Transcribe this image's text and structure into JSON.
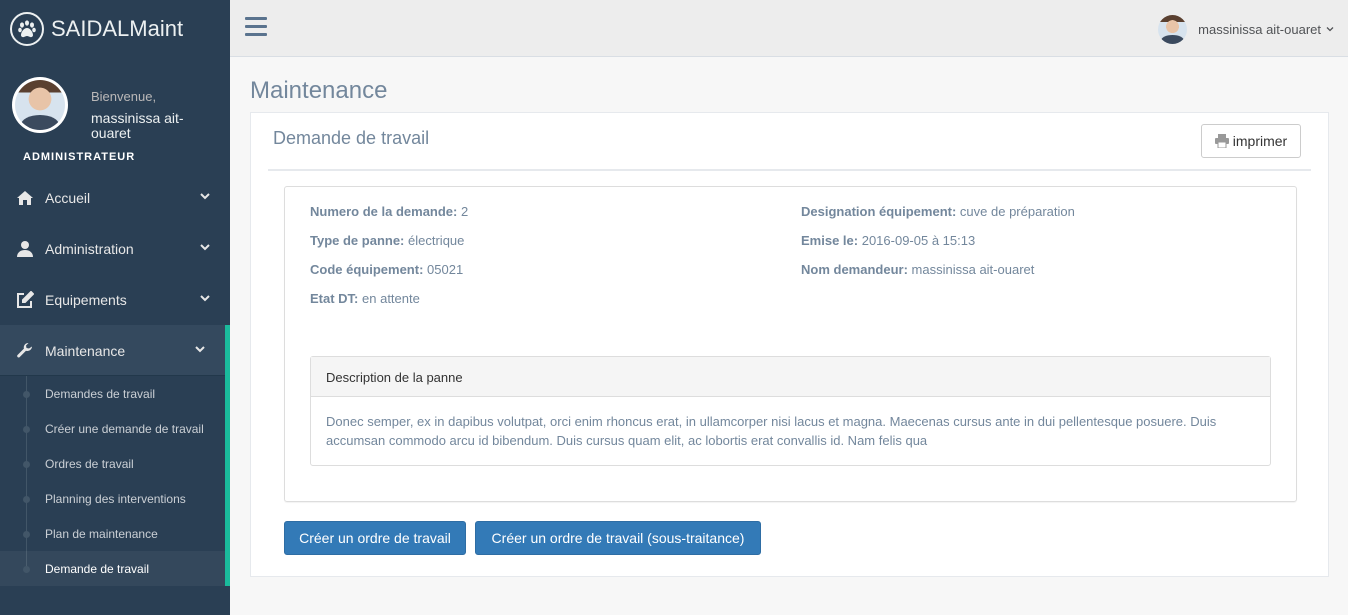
{
  "brand": {
    "name": "SAIDALMaint",
    "icon": "paw-icon"
  },
  "profile": {
    "welcome": "Bienvenue,",
    "name": "massinissa ait-ouaret",
    "role": "ADMINISTRATEUR"
  },
  "menu": [
    {
      "label": "Accueil",
      "icon": "home-icon"
    },
    {
      "label": "Administration",
      "icon": "user-icon"
    },
    {
      "label": "Equipements",
      "icon": "edit-icon"
    },
    {
      "label": "Maintenance",
      "icon": "wrench-icon"
    }
  ],
  "submenu": [
    {
      "label": "Demandes de travail"
    },
    {
      "label": "Créer une demande de travail"
    },
    {
      "label": "Ordres de travail"
    },
    {
      "label": "Planning des interventions"
    },
    {
      "label": "Plan de maintenance"
    },
    {
      "label": "Demande de travail"
    }
  ],
  "topnav": {
    "user": "massinissa ait-ouaret"
  },
  "page": {
    "title": "Maintenance"
  },
  "panel": {
    "title": "Demande de travail",
    "print_label": "imprimer",
    "fields": {
      "numero": {
        "label": "Numero de la demande:",
        "value": "2"
      },
      "type": {
        "label": "Type de panne:",
        "value": "électrique"
      },
      "code": {
        "label": "Code équipement:",
        "value": "05021"
      },
      "etat": {
        "label": "Etat DT:",
        "value": "en attente"
      },
      "designation": {
        "label": "Designation équipement:",
        "value": "cuve de préparation"
      },
      "emise": {
        "label": "Emise le:",
        "value": "2016-09-05 à 15:13"
      },
      "demandeur": {
        "label": "Nom demandeur:",
        "value": "massinissa ait-ouaret"
      }
    },
    "description": {
      "title": "Description de la panne",
      "text": "Donec semper, ex in dapibus volutpat, orci enim rhoncus erat, in ullamcorper nisi lacus et magna. Maecenas cursus ante in dui pellentesque posuere. Duis accumsan commodo arcu id bibendum. Duis cursus quam elit, ac lobortis erat convallis id. Nam felis qua"
    },
    "buttons": {
      "create_order": "Créer un ordre de travail",
      "create_order_sub": "Créer un ordre de travail (sous-traitance)"
    }
  }
}
